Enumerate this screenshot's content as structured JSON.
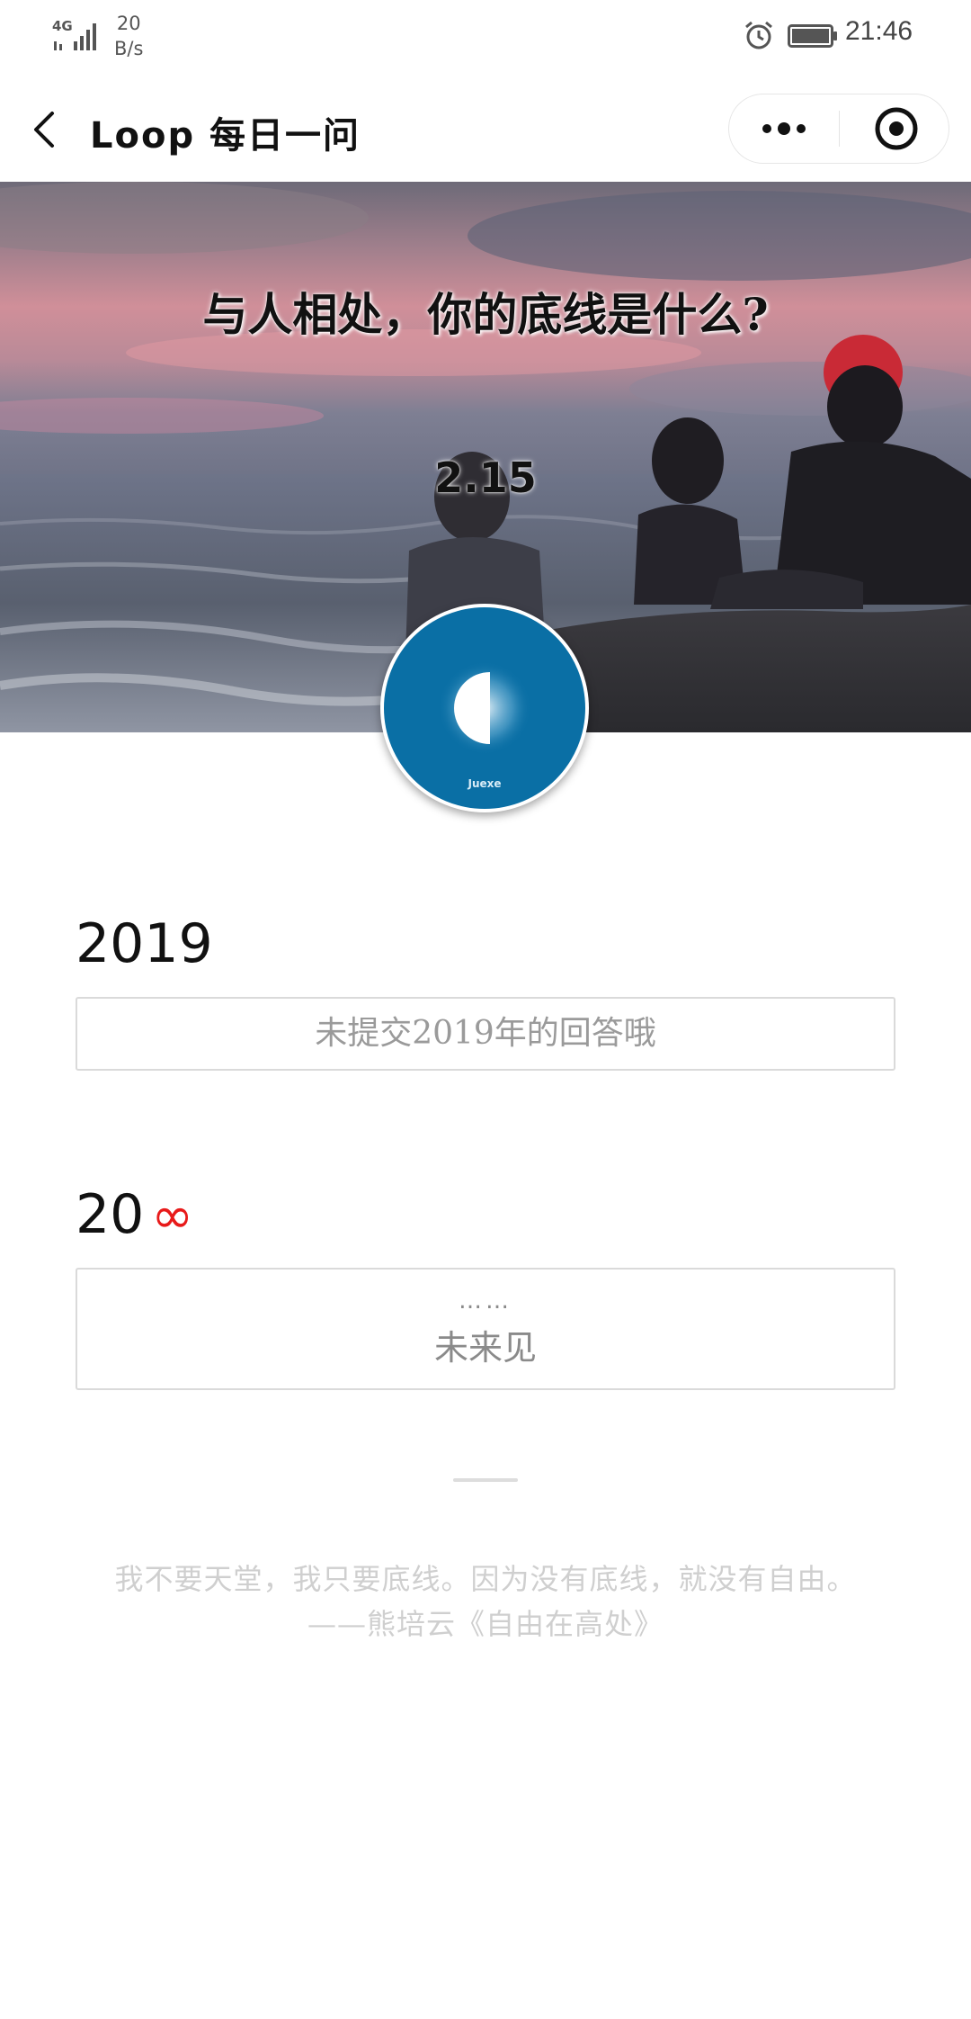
{
  "status_bar": {
    "network": "4G",
    "speed_value": "20",
    "speed_unit": "B/s",
    "time": "21:46"
  },
  "header": {
    "title": "Loop 每日一问"
  },
  "banner": {
    "question": "与人相处，你的底线是什么?",
    "date": "2.15"
  },
  "avatar": {
    "label": "Juexe"
  },
  "answers": [
    {
      "year": "2019",
      "text": "未提交2019年的回答哦"
    },
    {
      "year_prefix": "20",
      "year_symbol": "∞",
      "dots": "……",
      "text": "未来见"
    }
  ],
  "quote": {
    "line1": "我不要天堂，我只要底线。因为没有底线，就没有自由。",
    "line2": "——熊培云《自由在高处》"
  },
  "colors": {
    "infinity": "#e81a1a",
    "avatar_blue": "#0a6fa5",
    "border": "#dadada"
  },
  "icons": [
    "back-arrow-icon",
    "more-dots-icon",
    "close-target-icon",
    "alarm-icon",
    "battery-icon",
    "signal-icon"
  ]
}
